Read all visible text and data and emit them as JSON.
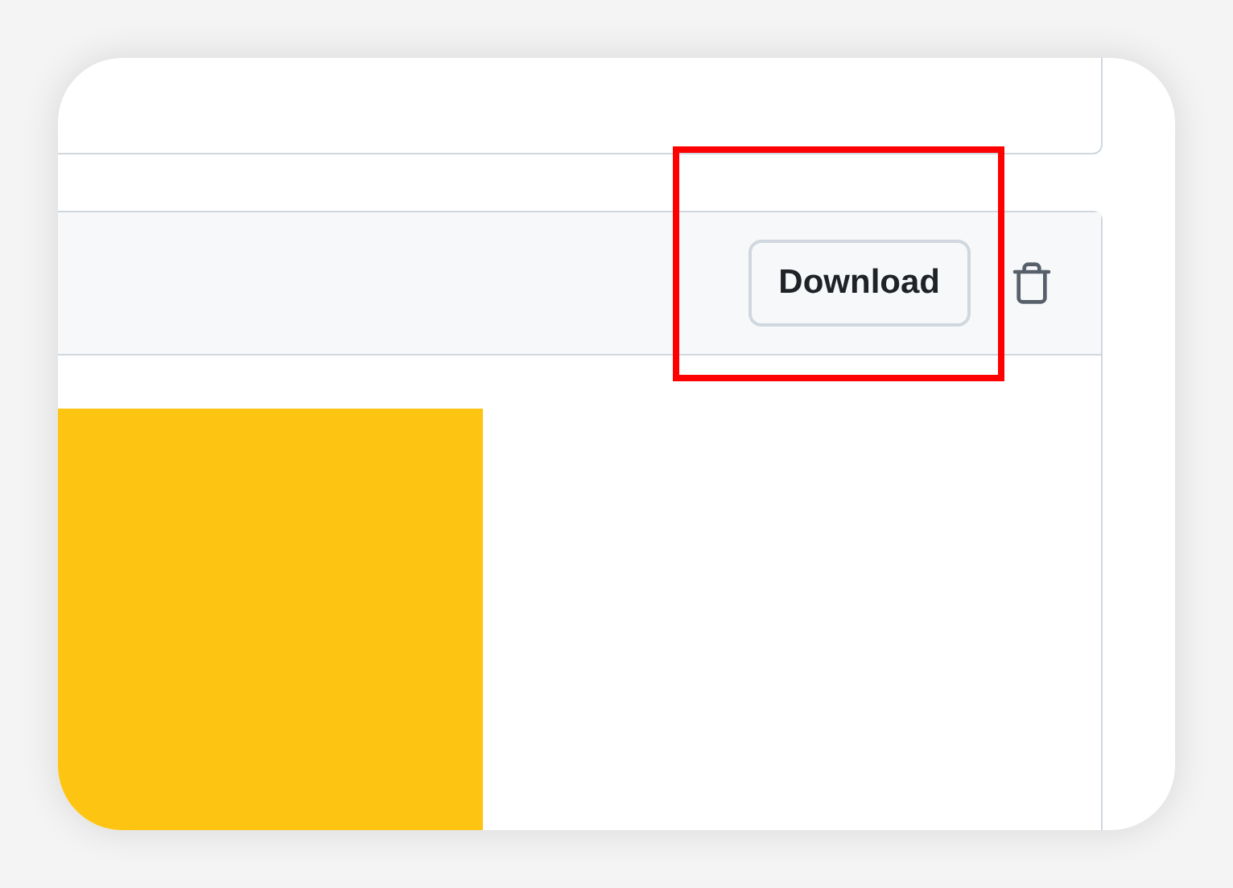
{
  "artifact_header": {
    "download_button": {
      "label": "Download"
    }
  }
}
